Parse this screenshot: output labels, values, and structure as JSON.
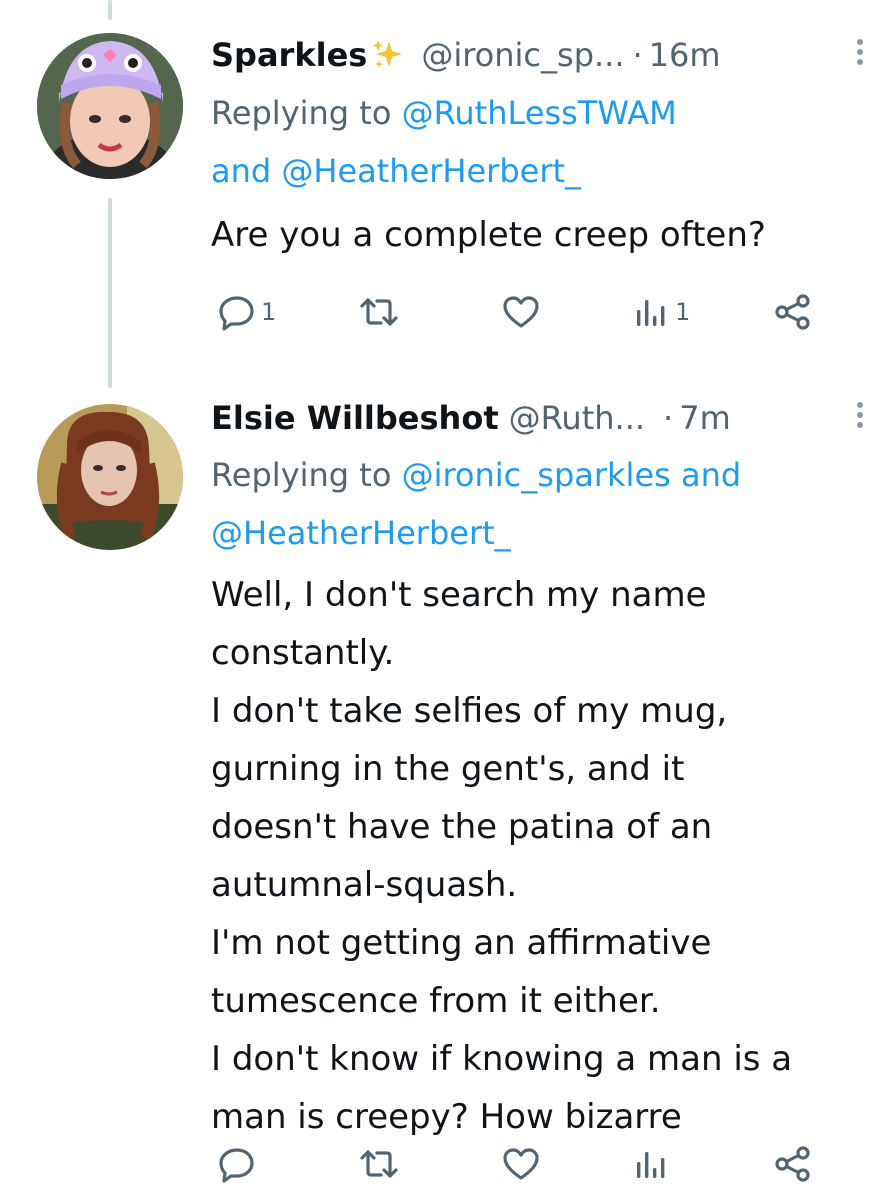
{
  "tweets": [
    {
      "name": "Sparkles",
      "handle": "@ironic_sp...",
      "dot": "·",
      "time": "16m",
      "replying_prefix": "Replying to",
      "mention1": "@RuthLessTWAM",
      "joiner": "and",
      "mention2": "@HeatherHerbert_",
      "text": "Are you a complete creep often?",
      "reply_count": "1",
      "retweet_count": "",
      "like_count": "",
      "view_count": "1",
      "name_icon": "sparkles-emoji-icon"
    },
    {
      "name": "Elsie Willbeshot",
      "handle": "@Ruth...",
      "dot": "·",
      "time": "7m",
      "replying_prefix": "Replying to",
      "mention1": "@ironic_sparkles",
      "joiner": "and",
      "mention2": "@HeatherHerbert_",
      "text": "Well, I don't search my name\nconstantly.\nI don't take selfies of my mug,\ngurning in the gent's, and it\ndoesn't have the patina of an\nautumnal-squash.\nI'm not getting an affirmative\ntumescence from it either.\nI don't know if knowing a man is a\nman is creepy? How bizarre",
      "reply_count": "",
      "retweet_count": "",
      "like_count": "",
      "view_count": ""
    }
  ],
  "colors": {
    "link": "#1d9bf0",
    "secondary": "#536471",
    "text": "#0f1419",
    "thread": "#cfd9de"
  }
}
